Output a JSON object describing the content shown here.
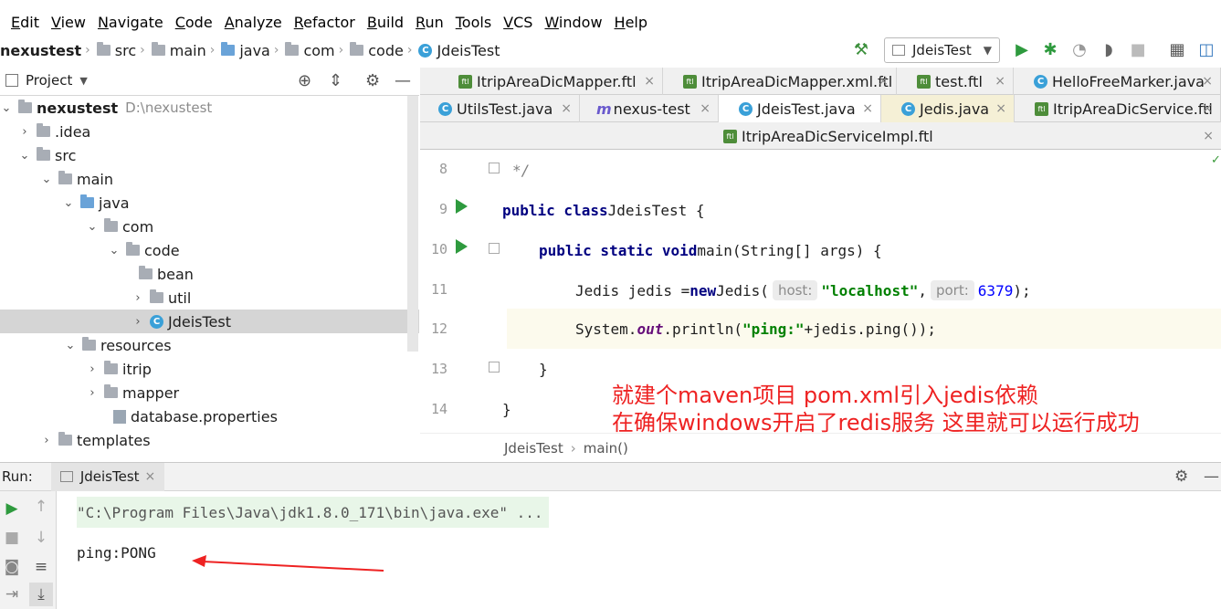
{
  "menu": [
    "Edit",
    "View",
    "Navigate",
    "Code",
    "Analyze",
    "Refactor",
    "Build",
    "Run",
    "Tools",
    "VCS",
    "Window",
    "Help"
  ],
  "breadcrumb": [
    "nexustest",
    "src",
    "main",
    "java",
    "com",
    "code",
    "JdeisTest"
  ],
  "toolbar": {
    "run_config": "JdeisTest"
  },
  "project_panel": {
    "title": "Project",
    "tree": [
      {
        "label": "nexustest",
        "path": "D:\\nexustest"
      },
      {
        "label": ".idea"
      },
      {
        "label": "src"
      },
      {
        "label": "main"
      },
      {
        "label": "java"
      },
      {
        "label": "com"
      },
      {
        "label": "code"
      },
      {
        "label": "bean"
      },
      {
        "label": "util"
      },
      {
        "label": "JdeisTest"
      },
      {
        "label": "resources"
      },
      {
        "label": "itrip"
      },
      {
        "label": "mapper"
      },
      {
        "label": "database.properties"
      },
      {
        "label": "templates"
      }
    ]
  },
  "tabs": {
    "row1": [
      "ItripAreaDicMapper.ftl",
      "ItripAreaDicMapper.xml.ftl",
      "test.ftl",
      "HelloFreeMarker.java"
    ],
    "row2": [
      "UtilsTest.java",
      "nexus-test",
      "JdeisTest.java",
      "Jedis.java",
      "ItripAreaDicService.ftl"
    ],
    "row3": [
      "ItripAreaDicServiceImpl.ftl"
    ],
    "close": "×",
    "nexus_prefix": "m"
  },
  "editor": {
    "line_numbers": [
      "8",
      "9",
      "10",
      "11",
      "12",
      "13",
      "14"
    ],
    "l8": "*/",
    "l9_kw": "public class",
    "l9_rest": " JdeisTest {",
    "l10_kw": "public static void",
    "l10_rest": " main(String[] args) {",
    "l11_a": "Jedis jedis = ",
    "l11_new": "new",
    "l11_b": " Jedis(",
    "l11_hint_host": "host:",
    "l11_str": "\"localhost\"",
    "l11_comma": ",",
    "l11_hint_port": "port:",
    "l11_num": "6379",
    "l11_end": ");",
    "l12_a": "System.",
    "l12_out": "out",
    "l12_b": ".println(",
    "l12_str": "\"ping:\"",
    "l12_c": "+jedis.ping());",
    "l13": "}",
    "l14": "}",
    "crumbs": [
      "JdeisTest",
      "main()"
    ]
  },
  "annotation": {
    "line1": "就建个maven项目 pom.xml引入jedis依赖",
    "line2": "在确保windows开启了redis服务  这里就可以运行成功"
  },
  "run_panel": {
    "label": "Run:",
    "tab": "JdeisTest",
    "command": "\"C:\\Program Files\\Java\\jdk1.8.0_171\\bin\\java.exe\" ...",
    "output": "ping:PONG"
  },
  "colors": {
    "annotation": "#ee2222",
    "run_green": "#2e9a3e",
    "keyword": "#000080",
    "string": "#008000"
  }
}
